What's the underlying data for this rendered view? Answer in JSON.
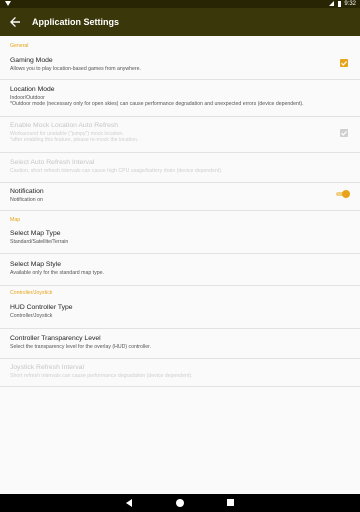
{
  "status_bar": {
    "time": "9:32"
  },
  "app_bar": {
    "title": "Application Settings"
  },
  "categories": {
    "general": "General",
    "map": "Map",
    "controller": "Controller/Joystick"
  },
  "prefs": {
    "gaming_mode": {
      "title": "Gaming Mode",
      "summary": "Allows you to play location-based games from anywhere.",
      "checked": true
    },
    "location_mode": {
      "title": "Location Mode",
      "summary1": "Indoor/Outdoor",
      "summary2": "*Outdoor mode (necessary only for open skies) can cause performance degradation and unexpected errors (device dependent)."
    },
    "mock_refresh": {
      "title": "Enable Mock Location Auto Refresh",
      "summary1": "Workaround for unstable (\"jumpy\") mock location.",
      "summary2": "*after enabling this feature, please re-mock the location.",
      "checked": true,
      "enabled": false
    },
    "refresh_interval": {
      "title": "Select Auto Refresh Interval",
      "summary": "Caution, short refresh intervals can cause high CPU usage/battery drain (device dependent).",
      "enabled": false
    },
    "notification": {
      "title": "Notification",
      "summary": "Notification on",
      "on": true
    },
    "map_type": {
      "title": "Select Map Type",
      "summary": "Standard/Satellite/Terrain"
    },
    "map_style": {
      "title": "Select Map Style",
      "summary": "Available only for the standard map type."
    },
    "hud_type": {
      "title": "HUD Controller Type",
      "summary": "Controller/Joystick"
    },
    "transparency": {
      "title": "Controller Transparency Level",
      "summary": "Select the transparency level for the overlay (HUD) controller."
    },
    "joystick_refresh": {
      "title": "Joystick Refresh Interval",
      "summary": "Short refresh intervals can cause performance degradation (device dependent).",
      "enabled": false
    }
  },
  "colors": {
    "accent": "#e8a419",
    "app_bar": "#3a370a",
    "status_bar": "#272503"
  }
}
